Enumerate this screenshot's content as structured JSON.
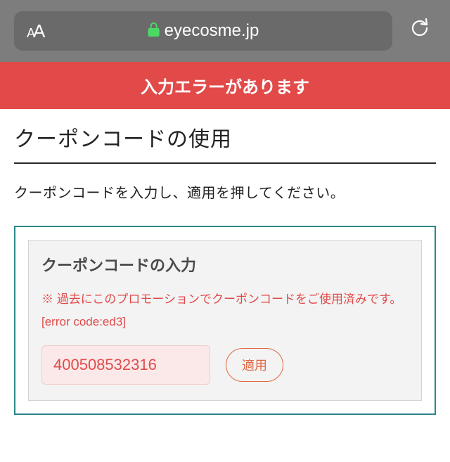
{
  "browser": {
    "url": "eyecosme.jp",
    "text_size_small": "A",
    "text_size_large": "A"
  },
  "error_banner": "入力エラーがあります",
  "page_title": "クーポンコードの使用",
  "instruction": "クーポンコードを入力し、適用を押してください。",
  "panel": {
    "title": "クーポンコードの入力",
    "error_message": "※ 過去にこのプロモーションでクーポンコードをご使用済みです。[error code:ed3]",
    "coupon_value": "400508532316",
    "apply_label": "適用"
  }
}
